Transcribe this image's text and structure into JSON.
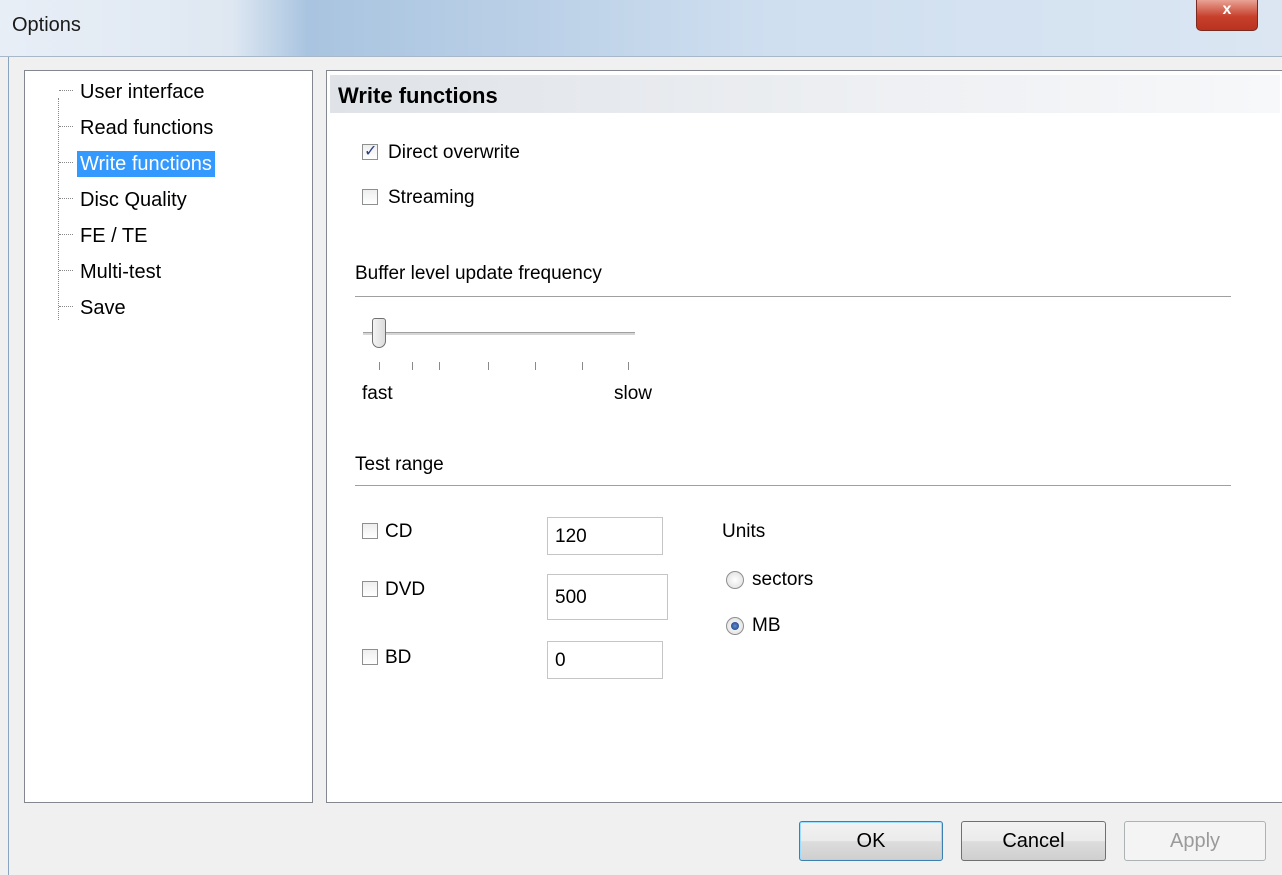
{
  "window": {
    "title": "Options",
    "close_glyph": "x"
  },
  "tree": {
    "items": [
      {
        "label": "User interface",
        "selected": false
      },
      {
        "label": "Read functions",
        "selected": false
      },
      {
        "label": "Write functions",
        "selected": true
      },
      {
        "label": "Disc Quality",
        "selected": false
      },
      {
        "label": "FE / TE",
        "selected": false
      },
      {
        "label": "Multi-test",
        "selected": false
      },
      {
        "label": "Save",
        "selected": false
      }
    ]
  },
  "page": {
    "header": "Write functions",
    "direct_overwrite": {
      "label": "Direct overwrite",
      "checked": true
    },
    "streaming": {
      "label": "Streaming",
      "checked": false
    },
    "buffer_group": {
      "title": "Buffer level update frequency",
      "min_label": "fast",
      "max_label": "slow",
      "level": 0,
      "ticks": 7
    },
    "test_range": {
      "title": "Test range",
      "cd": {
        "label": "CD",
        "checked": false,
        "value": "120"
      },
      "dvd": {
        "label": "DVD",
        "checked": false,
        "value": "500"
      },
      "bd": {
        "label": "BD",
        "checked": false,
        "value": "0"
      },
      "units": {
        "title": "Units",
        "options": [
          {
            "label": "sectors",
            "selected": false
          },
          {
            "label": "MB",
            "selected": true
          }
        ]
      }
    }
  },
  "buttons": {
    "ok": "OK",
    "cancel": "Cancel",
    "apply": "Apply"
  },
  "colors": {
    "selection": "#3399ff",
    "close": "#c7402c"
  }
}
